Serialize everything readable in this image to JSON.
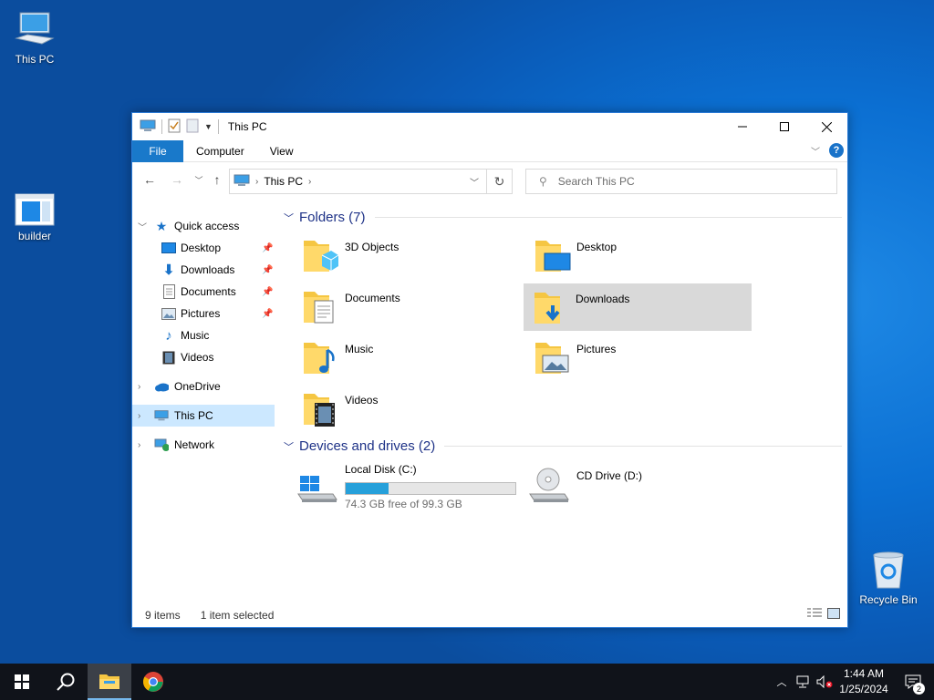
{
  "desktop": {
    "icons": [
      {
        "label": "This PC"
      },
      {
        "label": "builder"
      },
      {
        "label": "Recycle Bin"
      }
    ]
  },
  "window": {
    "title": "This PC",
    "ribbon_tabs": [
      "File",
      "Computer",
      "View"
    ],
    "address": {
      "path": [
        "This PC"
      ]
    },
    "search_placeholder": "Search This PC",
    "nav": [
      {
        "label": "Quick access"
      },
      {
        "label": "Desktop"
      },
      {
        "label": "Downloads"
      },
      {
        "label": "Documents"
      },
      {
        "label": "Pictures"
      },
      {
        "label": "Music"
      },
      {
        "label": "Videos"
      },
      {
        "label": "OneDrive"
      },
      {
        "label": "This PC"
      },
      {
        "label": "Network"
      }
    ],
    "folders_header": "Folders (7)",
    "folders": [
      {
        "label": "3D Objects"
      },
      {
        "label": "Desktop"
      },
      {
        "label": "Documents"
      },
      {
        "label": "Downloads"
      },
      {
        "label": "Music"
      },
      {
        "label": "Pictures"
      },
      {
        "label": "Videos"
      }
    ],
    "devices_header": "Devices and drives (2)",
    "drives": [
      {
        "label": "Local Disk (C:)",
        "free_text": "74.3 GB free of 99.3 GB",
        "used_fraction": 0.252
      },
      {
        "label": "CD Drive (D:)"
      }
    ],
    "status": {
      "items": "9 items",
      "selected": "1 item selected"
    }
  },
  "taskbar": {
    "time": "1:44 AM",
    "date": "1/25/2024",
    "notification_count": "2"
  },
  "colors": {
    "accent": "#1979ca",
    "selection": "#cce8ff",
    "progress": "#26a0da"
  }
}
